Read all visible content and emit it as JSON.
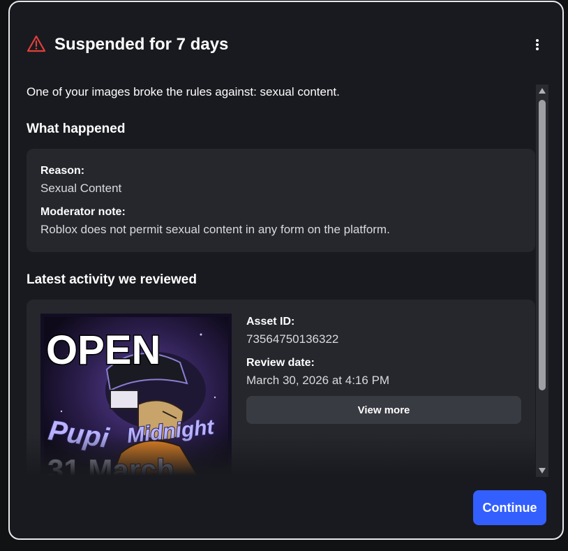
{
  "dialog": {
    "title": "Suspended for 7 days",
    "accent_color": "#e0403a"
  },
  "intro": "One of your images broke the rules against: sexual content.",
  "what_happened": {
    "heading": "What happened",
    "reason_label": "Reason:",
    "reason_value": "Sexual Content",
    "note_label": "Moderator note:",
    "note_value": "Roblox does not permit sexual content in any form on the platform."
  },
  "latest_activity": {
    "heading": "Latest activity we reviewed",
    "asset_id_label": "Asset ID:",
    "asset_id_value": "73564750136322",
    "review_date_label": "Review date:",
    "review_date_value": "March 30, 2026 at 4:16 PM",
    "view_more_label": "View more",
    "image_text": {
      "top": "OPEN",
      "name": "Pupi",
      "event": "Midnight",
      "date": "31 March"
    }
  },
  "footer": {
    "continue_label": "Continue",
    "primary_color": "#335fff"
  }
}
